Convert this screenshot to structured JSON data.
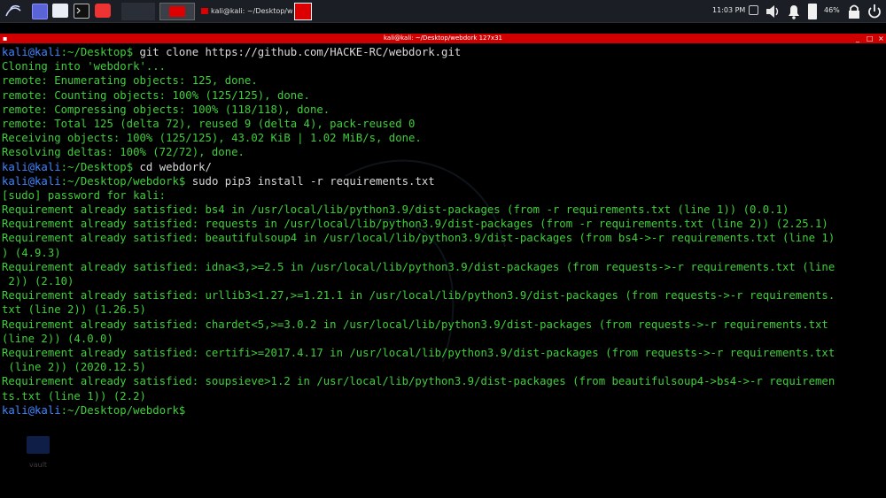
{
  "taskbar": {
    "clock": "11:03 PM",
    "battery": "46%",
    "task_title": "kali@kali: ~/Desktop/we…",
    "icons": [
      "kali-menu-icon",
      "workspace-icon",
      "file-manager-icon",
      "terminal-icon",
      "screen-recorder-icon",
      "notification-icon",
      "volume-icon",
      "bell-icon",
      "battery-icon",
      "lock-icon",
      "power-icon"
    ]
  },
  "window": {
    "title": "kali@kali: ~/Desktop/webdork 127x31",
    "controls": [
      "_",
      "□",
      "×"
    ]
  },
  "prompt": {
    "user": "kali",
    "host": "kali"
  },
  "desktop": {
    "folder_label": "vault"
  },
  "terminal": {
    "lines": [
      {
        "kind": "prompt",
        "user": "kali",
        "at": "@",
        "host": "kali",
        "path": ":~/Desktop$ ",
        "cmd": "git clone https://github.com/HACKE-RC/webdork.git"
      },
      {
        "kind": "out",
        "text": "Cloning into 'webdork'..."
      },
      {
        "kind": "out",
        "text": "remote: Enumerating objects: 125, done."
      },
      {
        "kind": "out",
        "text": "remote: Counting objects: 100% (125/125), done."
      },
      {
        "kind": "out",
        "text": "remote: Compressing objects: 100% (118/118), done."
      },
      {
        "kind": "out",
        "text": "remote: Total 125 (delta 72), reused 9 (delta 4), pack-reused 0"
      },
      {
        "kind": "out",
        "text": "Receiving objects: 100% (125/125), 43.02 KiB | 1.02 MiB/s, done."
      },
      {
        "kind": "out",
        "text": "Resolving deltas: 100% (72/72), done."
      },
      {
        "kind": "prompt",
        "user": "kali",
        "at": "@",
        "host": "kali",
        "path": ":~/Desktop$ ",
        "cmd": "cd webdork/"
      },
      {
        "kind": "prompt",
        "user": "kali",
        "at": "@",
        "host": "kali",
        "path": ":~/Desktop/webdork$ ",
        "cmd": "sudo pip3 install -r requirements.txt"
      },
      {
        "kind": "out",
        "text": "[sudo] password for kali:"
      },
      {
        "kind": "out",
        "text": "Requirement already satisfied: bs4 in /usr/local/lib/python3.9/dist-packages (from -r requirements.txt (line 1)) (0.0.1)"
      },
      {
        "kind": "out",
        "text": "Requirement already satisfied: requests in /usr/local/lib/python3.9/dist-packages (from -r requirements.txt (line 2)) (2.25.1)"
      },
      {
        "kind": "out",
        "text": "Requirement already satisfied: beautifulsoup4 in /usr/local/lib/python3.9/dist-packages (from bs4->-r requirements.txt (line 1)"
      },
      {
        "kind": "out",
        "text": ") (4.9.3)"
      },
      {
        "kind": "out",
        "text": "Requirement already satisfied: idna<3,>=2.5 in /usr/local/lib/python3.9/dist-packages (from requests->-r requirements.txt (line"
      },
      {
        "kind": "out",
        "text": " 2)) (2.10)"
      },
      {
        "kind": "out",
        "text": "Requirement already satisfied: urllib3<1.27,>=1.21.1 in /usr/local/lib/python3.9/dist-packages (from requests->-r requirements."
      },
      {
        "kind": "out",
        "text": "txt (line 2)) (1.26.5)"
      },
      {
        "kind": "out",
        "text": "Requirement already satisfied: chardet<5,>=3.0.2 in /usr/local/lib/python3.9/dist-packages (from requests->-r requirements.txt"
      },
      {
        "kind": "out",
        "text": "(line 2)) (4.0.0)"
      },
      {
        "kind": "out",
        "text": "Requirement already satisfied: certifi>=2017.4.17 in /usr/local/lib/python3.9/dist-packages (from requests->-r requirements.txt"
      },
      {
        "kind": "out",
        "text": " (line 2)) (2020.12.5)"
      },
      {
        "kind": "out",
        "text": "Requirement already satisfied: soupsieve>1.2 in /usr/local/lib/python3.9/dist-packages (from beautifulsoup4->bs4->-r requiremen"
      },
      {
        "kind": "out",
        "text": "ts.txt (line 1)) (2.2)"
      },
      {
        "kind": "prompt",
        "user": "kali",
        "at": "@",
        "host": "kali",
        "path": ":~/Desktop/webdork$ ",
        "cmd": ""
      }
    ]
  },
  "colors": {
    "taskbar_bg": "#1b1e24",
    "titlebar_bg": "#d00000",
    "output_green": "#3fcf3a",
    "prompt_blue": "#3f86ff",
    "command_text": "#d9d9d9"
  }
}
